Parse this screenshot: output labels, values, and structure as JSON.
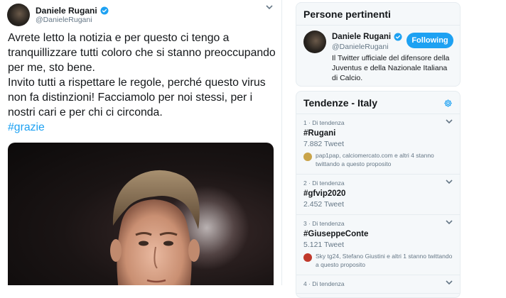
{
  "tweet": {
    "author_name": "Daniele Rugani",
    "author_handle": "@DanieleRugani",
    "text_paragraph_1": "Avrete letto la notizia e per questo ci tengo a tranquillizzare tutti coloro che si stanno preoccupando per me, sto bene.",
    "text_paragraph_2": "Invito tutti a rispettare le regole, perché questo virus non fa distinzioni! Facciamolo per noi stessi, per i nostri cari e per chi ci circonda.",
    "hashtag": "#grazie",
    "verified": true
  },
  "people_card": {
    "title": "Persone pertinenti",
    "name": "Daniele Rugani",
    "handle": "@DanieleRugani",
    "follow_label": "Following",
    "bio": "Il Twitter ufficiale del difensore della Juventus e della Nazionale Italiana di Calcio."
  },
  "trends_card": {
    "title": "Tendenze - Italy",
    "items": [
      {
        "meta": "1 · Di tendenza",
        "tag": "#Rugani",
        "count": "7.882 Tweet",
        "related": "pap1pap, calciomercato.com e altri 4 stanno twittando a questo proposito"
      },
      {
        "meta": "2 · Di tendenza",
        "tag": "#gfvip2020",
        "count": "2.452 Tweet"
      },
      {
        "meta": "3 · Di tendenza",
        "tag": "#GiuseppeConte",
        "count": "5.121 Tweet",
        "related": "Sky tg24, Stefano Giustini e altri 1 stanno twittando a questo proposito"
      },
      {
        "meta": "4 · Di tendenza"
      }
    ]
  },
  "colors": {
    "accent": "#1da1f2",
    "text": "#14171a",
    "secondary": "#657786",
    "border": "#e6ecf0",
    "card_bg": "#f5f8fa"
  },
  "icons": [
    "verified-badge-icon",
    "chevron-down-icon",
    "gear-icon"
  ]
}
